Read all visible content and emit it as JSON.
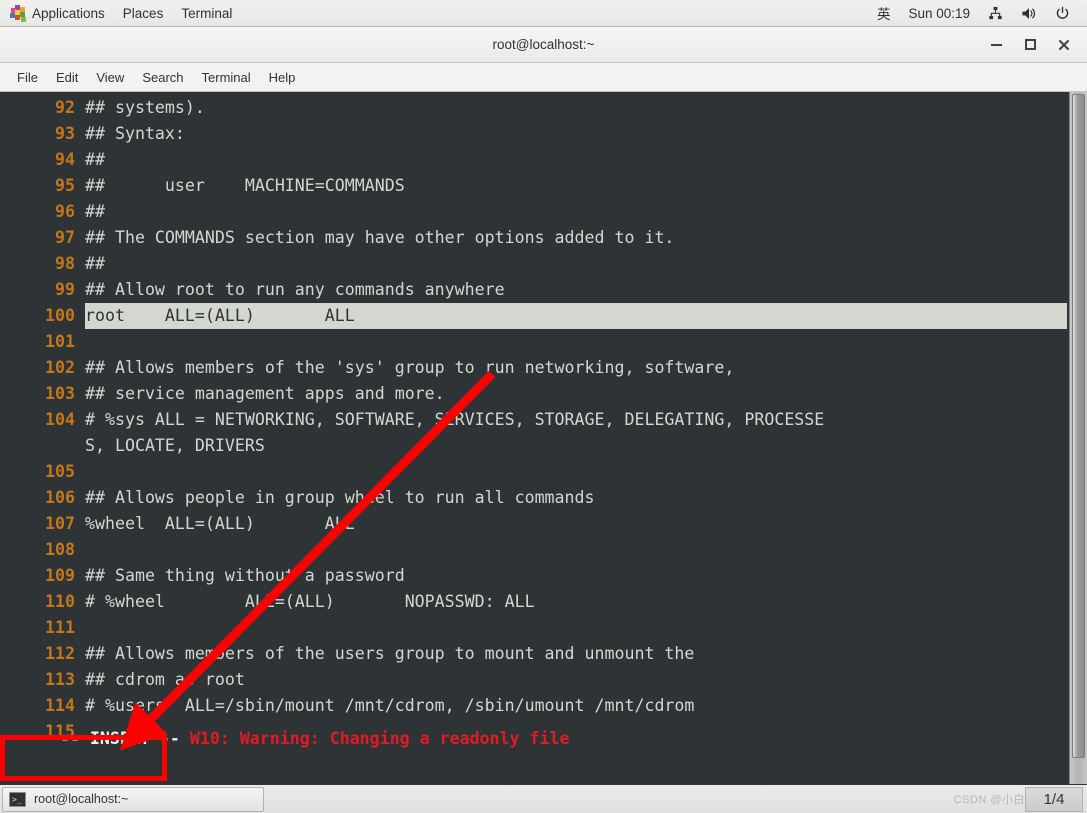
{
  "top_panel": {
    "apps_label": "Applications",
    "places_label": "Places",
    "terminal_label": "Terminal",
    "input_method": "英",
    "clock": "Sun 00:19",
    "network_icon": "network-icon",
    "volume_icon": "volume-icon",
    "power_icon": "power-icon"
  },
  "window": {
    "title": "root@localhost:~",
    "minimize_label": "—",
    "maximize_label": "□",
    "close_label": "✕"
  },
  "menubar": {
    "items": [
      {
        "label": "File"
      },
      {
        "label": "Edit"
      },
      {
        "label": "View"
      },
      {
        "label": "Search"
      },
      {
        "label": "Terminal"
      },
      {
        "label": "Help"
      }
    ]
  },
  "editor": {
    "lines": [
      {
        "num": "92",
        "text": "## systems).",
        "highlight": false,
        "wrap": false
      },
      {
        "num": "93",
        "text": "## Syntax:",
        "highlight": false,
        "wrap": false
      },
      {
        "num": "94",
        "text": "##",
        "highlight": false,
        "wrap": false
      },
      {
        "num": "95",
        "text": "##      user    MACHINE=COMMANDS",
        "highlight": false,
        "wrap": false
      },
      {
        "num": "96",
        "text": "##",
        "highlight": false,
        "wrap": false
      },
      {
        "num": "97",
        "text": "## The COMMANDS section may have other options added to it.",
        "highlight": false,
        "wrap": false
      },
      {
        "num": "98",
        "text": "##",
        "highlight": false,
        "wrap": false
      },
      {
        "num": "99",
        "text": "## Allow root to run any commands anywhere",
        "highlight": false,
        "wrap": false
      },
      {
        "num": "100",
        "text": "root    ALL=(ALL)       ALL",
        "highlight": true,
        "wrap": false
      },
      {
        "num": "101",
        "text": "",
        "highlight": false,
        "wrap": false
      },
      {
        "num": "102",
        "text": "## Allows members of the 'sys' group to run networking, software,",
        "highlight": false,
        "wrap": false
      },
      {
        "num": "103",
        "text": "## service management apps and more.",
        "highlight": false,
        "wrap": false
      },
      {
        "num": "104",
        "text": "# %sys ALL = NETWORKING, SOFTWARE, SERVICES, STORAGE, DELEGATING, PROCESSE",
        "highlight": false,
        "wrap": false
      },
      {
        "num": "104",
        "text": "S, LOCATE, DRIVERS",
        "highlight": false,
        "wrap": true
      },
      {
        "num": "105",
        "text": "",
        "highlight": false,
        "wrap": false
      },
      {
        "num": "106",
        "text": "## Allows people in group wheel to run all commands",
        "highlight": false,
        "wrap": false
      },
      {
        "num": "107",
        "text": "%wheel  ALL=(ALL)       ALL",
        "highlight": false,
        "wrap": false
      },
      {
        "num": "108",
        "text": "",
        "highlight": false,
        "wrap": false
      },
      {
        "num": "109",
        "text": "## Same thing without a password",
        "highlight": false,
        "wrap": false
      },
      {
        "num": "110",
        "text": "# %wheel        ALL=(ALL)       NOPASSWD: ALL",
        "highlight": false,
        "wrap": false
      },
      {
        "num": "111",
        "text": "",
        "highlight": false,
        "wrap": false
      },
      {
        "num": "112",
        "text": "## Allows members of the users group to mount and unmount the",
        "highlight": false,
        "wrap": false
      },
      {
        "num": "113",
        "text": "## cdrom as root",
        "highlight": false,
        "wrap": false
      },
      {
        "num": "114",
        "text": "# %users  ALL=/sbin/mount /mnt/cdrom, /sbin/umount /mnt/cdrom",
        "highlight": false,
        "wrap": false
      },
      {
        "num": "115",
        "text": "",
        "highlight": false,
        "wrap": false
      }
    ],
    "mode": "-- INSERT --",
    "warning": "W10: Warning: Changing a readonly file"
  },
  "annotations": {
    "highlight_color": "#ff0000",
    "arrow_name": "red-arrow-pointing-to-insert-mode",
    "box_name": "red-box-around-insert-mode"
  },
  "taskbar": {
    "window_button_label": "root@localhost:~",
    "terminal_icon": "terminal-icon",
    "workspace_indicator": "1/4",
    "watermark": "CSDN @小白"
  }
}
